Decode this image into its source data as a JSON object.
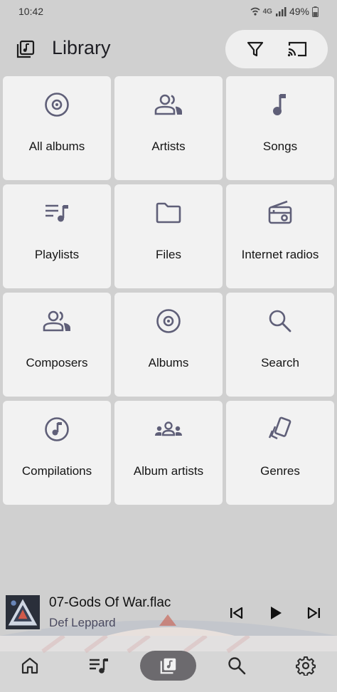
{
  "status_bar": {
    "time": "10:42",
    "network": "4G",
    "battery": "49%"
  },
  "header": {
    "title": "Library",
    "icons": [
      "library-icon",
      "filter-icon",
      "cast-icon"
    ]
  },
  "tiles": [
    {
      "label": "All albums",
      "icon": "disc-icon"
    },
    {
      "label": "Artists",
      "icon": "people-icon"
    },
    {
      "label": "Songs",
      "icon": "music-note-icon"
    },
    {
      "label": "Playlists",
      "icon": "playlist-icon"
    },
    {
      "label": "Files",
      "icon": "folder-icon"
    },
    {
      "label": "Internet radios",
      "icon": "radio-icon"
    },
    {
      "label": "Composers",
      "icon": "people-icon"
    },
    {
      "label": "Albums",
      "icon": "disc-icon"
    },
    {
      "label": "Search",
      "icon": "search-icon"
    },
    {
      "label": "Compilations",
      "icon": "circled-note-icon"
    },
    {
      "label": "Album artists",
      "icon": "group-icon"
    },
    {
      "label": "Genres",
      "icon": "genre-card-icon"
    }
  ],
  "now_playing": {
    "track": "07-Gods Of War.flac",
    "artist": "Def Leppard"
  },
  "nav": [
    "home-icon",
    "queue-icon",
    "library-icon",
    "search-icon",
    "settings-icon"
  ],
  "colors": {
    "icon": "#5f5f78",
    "tile": "#f2f2f2",
    "background": "#d0d0d0",
    "nav_active": "#6c6a6e"
  }
}
